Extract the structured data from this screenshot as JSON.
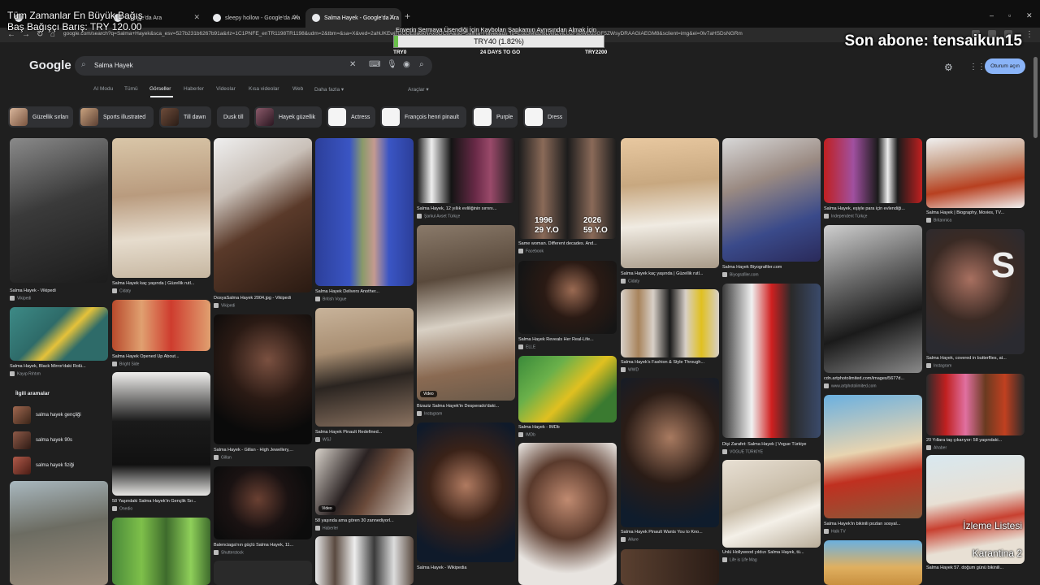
{
  "colors": {
    "page_bg": "#1f1f1f",
    "tabbar_bg": "#0f0f0f",
    "accent_button": "#8ab4f8",
    "goal_fill": "#6abf4b"
  },
  "browser": {
    "tabs": [
      {
        "label": "Google'da Ara",
        "active": false
      },
      {
        "label": "sleepy hollow - Google'da Ara",
        "active": false
      },
      {
        "label": "Salma Hayek - Google'da Ara",
        "active": true
      }
    ],
    "url": "google.com/search?q=Salma+Hayek&sca_esv=527b231b6267b91a&rlz=1C1PNFE_enTR1198TR1198&udm=2&tbm=&sa=X&ved=2ahUKEwiH2ODE8a6kNAxUDC8A&oq=Salma+Hayek&gs_lp=Egd3Mtd2l6LWltZyILU2FsbWEgSGF5ZWsyDRAAGIAEGM8&sclient=img&ei=0lv7aHSDsNGRm"
  },
  "overlay": {
    "donation_line1": "Tüm Zamanlar En Büyük Bağış",
    "donation_line2": "Baş Bağışçı Barış: TRY 120.00",
    "subscriber": "Son abone: tensaikun15",
    "goal_title": "Enverin Sermaya Üsendiği İçin Kaybolan Şapkamın Aynısından Almak İçin",
    "goal_progress_text": "TRY40 (1.82%)",
    "goal_fraction": 0.0182,
    "goal_min": "TRY0",
    "goal_days": "24 DAYS TO GO",
    "goal_max": "TRY2200",
    "bottom_right_1": "İzleme Listesi",
    "bottom_right_2": "Karantina 2"
  },
  "google": {
    "logo": "Google",
    "search_value": "Salma Hayek",
    "signin_label": "Oturum açın",
    "nav_tabs": [
      "AI Modu",
      "Tümü",
      "Görseller",
      "Haberler",
      "Videolar",
      "Kısa videolar",
      "Web",
      "Daha fazla ▾",
      "Araçlar ▾"
    ],
    "active_tab": "Görseller",
    "chips": [
      "Güzellik sırları",
      "Sports illustrated",
      "Till dawn",
      "Dusk till",
      "Hayek güzellik",
      "Actress",
      "François henri pinault",
      "Purple",
      "Dress"
    ]
  },
  "related": {
    "title": "İlgili aramalar",
    "items": [
      "salma hayek gençliği",
      "salma hayek 90s",
      "salma hayek fiziği"
    ]
  },
  "results": [
    {
      "caption": "Salma Hayek - Vikipedi",
      "source": "Vikipedi"
    },
    {
      "caption": "Salma Hayek, Black Mirror'daki Rolü...",
      "source": "Kayıp Rıhtım"
    },
    {
      "caption": "",
      "source": ""
    },
    {
      "caption": "Salma Hayek kaç yaşında | Güzellik rutl...",
      "source": "Cidaty"
    },
    {
      "caption": "Salma Hayek Opened Up About...",
      "source": "Bright Side"
    },
    {
      "caption": "58 Yaşındaki Salma Hayek'in Gençlik Sır...",
      "source": "Onedio"
    },
    {
      "caption": "",
      "source": ""
    },
    {
      "caption": "DosyaSalma Hayek 2004.jpg - Vikipedi",
      "source": "Vikipedi"
    },
    {
      "caption": "Salma Hayek - Gillan - High Jewellery,...",
      "source": "Gillan"
    },
    {
      "caption": "Balenciaga'nın güçlü Salma Hayek, 11...",
      "source": "Shutterstock"
    },
    {
      "caption": "Salma Hayek Delivers Another...",
      "source": "British Vogue"
    },
    {
      "caption": "Salma Hayek Pinault Redefined...",
      "source": "WSJ"
    },
    {
      "caption": "58 yaşında ama gören 30 zannediyorl...",
      "source": "Haberler"
    },
    {
      "caption": "",
      "source": ""
    },
    {
      "caption": "Salma Hayek, 12 yıllık evliliğinin sırrını...",
      "source": "Şarkul Avset Türkçe"
    },
    {
      "caption": "Bizaziz Salma Hayek'in Desperado'daki...",
      "source": "Instagram"
    },
    {
      "caption": "Salma Hayek - Wikipedia",
      "source": ""
    },
    {
      "caption": "Same woman. Different decades. And...",
      "source": "Facebook"
    },
    {
      "caption": "Salma Hayek Reveals Her Real-Life...",
      "source": "ELLE"
    },
    {
      "caption": "Salma Hayek - IMDb",
      "source": "IMDb"
    },
    {
      "caption": "",
      "source": ""
    },
    {
      "caption": "Salma Hayek kaç yaşında | Güzellik rutl...",
      "source": "Cidaty"
    },
    {
      "caption": "Salma Hayek's Fashion & Style Through...",
      "source": "WWD"
    },
    {
      "caption": "Salma Hayek Pinault Wants You to Kno...",
      "source": "Allure"
    },
    {
      "caption": "",
      "source": ""
    },
    {
      "caption": "Salma Hayek Biyografiler.com",
      "source": "Biyografiler.com"
    },
    {
      "caption": "Dişi Zarafet: Salma Hayek | Vogue Türkiye",
      "source": "VOGUE TÜRKİYE"
    },
    {
      "caption": "Ünlü Hollywood yıldızı Salma Hayek, tü...",
      "source": "Life is Life Mag"
    },
    {
      "caption": "Salma Hayek, eşiyle para için evlendiği...",
      "source": "Independent Türkçe"
    },
    {
      "caption": "cdn.artphotolimited.com/images/5677d...",
      "source": "www.artphotolimited.com"
    },
    {
      "caption": "Salma Hayek'in bikinili pozları sosyal...",
      "source": "Halk TV"
    },
    {
      "caption": "",
      "source": ""
    },
    {
      "caption": "Salma Hayek | Biography, Movies, TV...",
      "source": "Britannica"
    },
    {
      "caption": "Salma Hayek, covered in butterflies, at...",
      "source": "Instagram"
    },
    {
      "caption": "20 Yıllara taş çıkarıyor: 58 yaşındaki...",
      "source": "Ahaber"
    },
    {
      "caption": "Salma Hayek 57. doğum günü bikinili...",
      "source": "Ahaber"
    }
  ],
  "labels": {
    "video": "Video",
    "year_left": "1996",
    "age_left": "29 Y.O",
    "year_right": "2026",
    "age_right": "59 Y.O",
    "logo_s": "S"
  }
}
